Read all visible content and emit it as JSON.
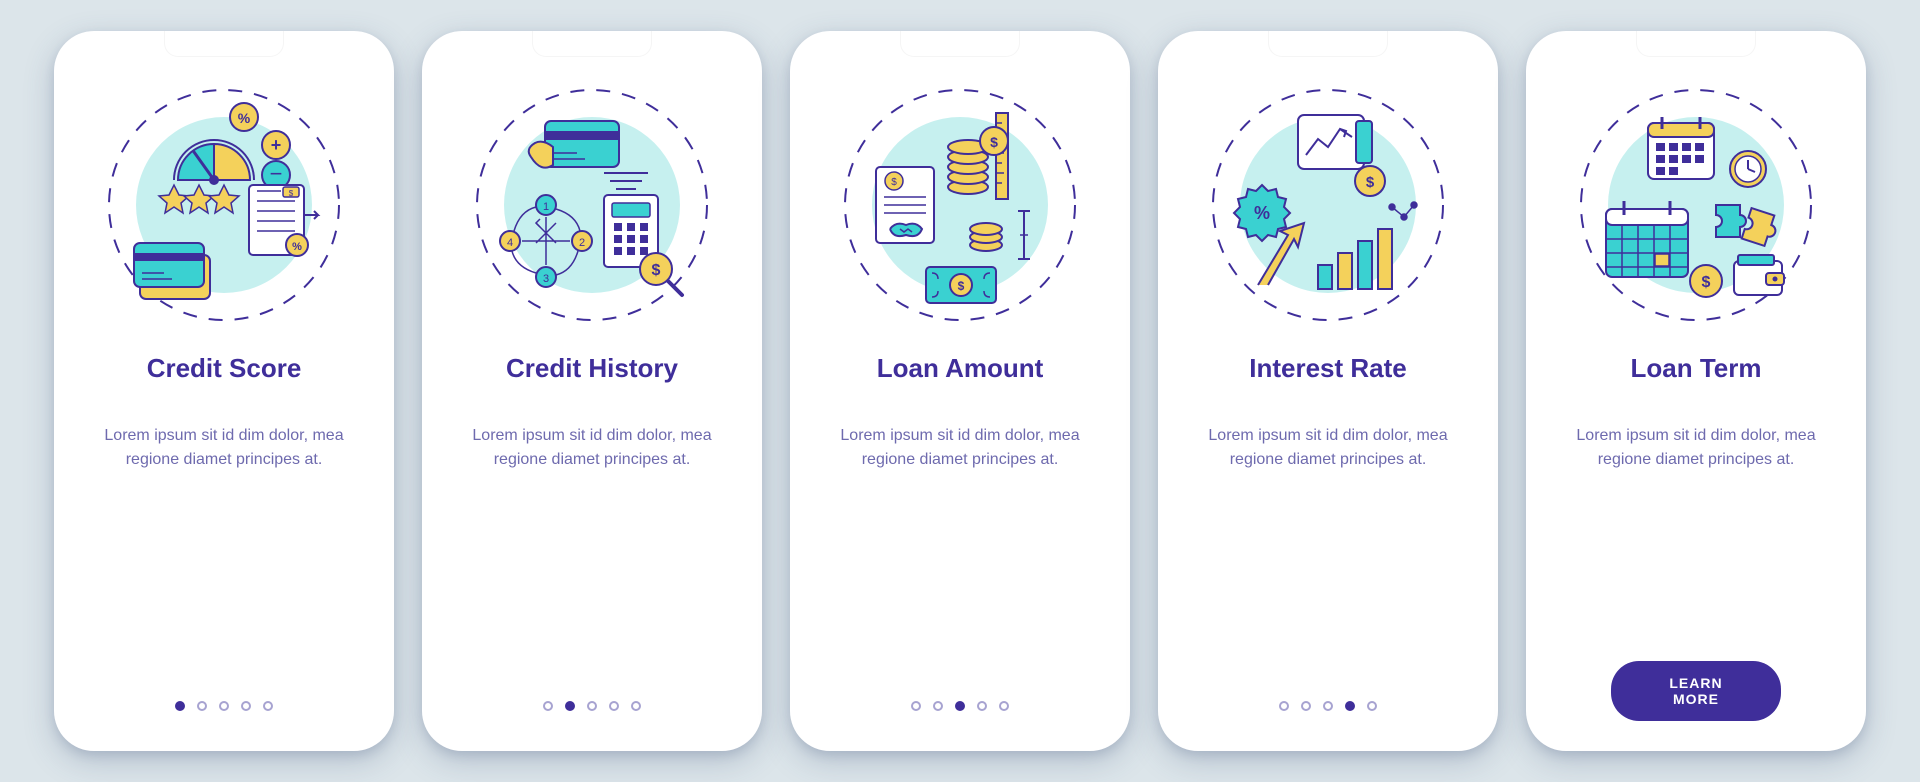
{
  "screens": [
    {
      "title": "Credit Score",
      "body": "Lorem ipsum sit id dim dolor, mea regione diamet principes at.",
      "icon": "credit-score",
      "active_dot": 0,
      "has_button": false
    },
    {
      "title": "Credit History",
      "body": "Lorem ipsum sit id dim dolor, mea regione diamet principes at.",
      "icon": "credit-history",
      "active_dot": 1,
      "has_button": false
    },
    {
      "title": "Loan Amount",
      "body": "Lorem ipsum sit id dim dolor, mea regione diamet principes at.",
      "icon": "loan-amount",
      "active_dot": 2,
      "has_button": false
    },
    {
      "title": "Interest Rate",
      "body": "Lorem ipsum sit id dim dolor, mea regione diamet principes at.",
      "icon": "interest-rate",
      "active_dot": 3,
      "has_button": false
    },
    {
      "title": "Loan Term",
      "body": "Lorem ipsum sit id dim dolor, mea regione diamet principes at.",
      "icon": "loan-term",
      "active_dot": null,
      "has_button": true
    }
  ],
  "total_dots": 5,
  "cta_label": "LEARN MORE",
  "palette": {
    "purple": "#3F2E9A",
    "text": "#6E6AAE",
    "yellow": "#F4D15B",
    "teal": "#3AD1D1",
    "light_teal": "#C6F0EF",
    "bg": "#DCE5EA"
  }
}
